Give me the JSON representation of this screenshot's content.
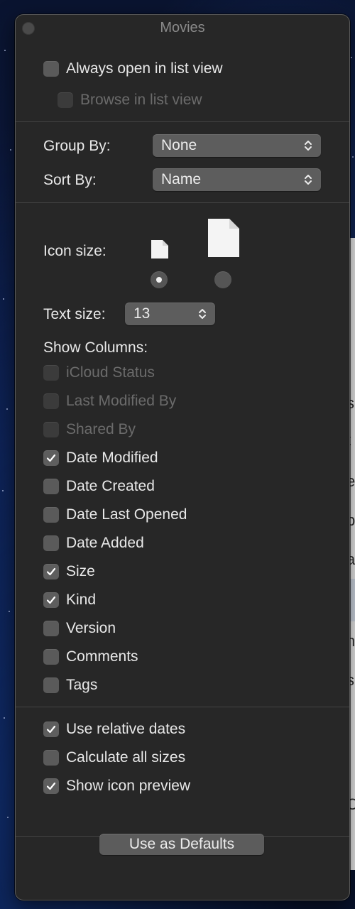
{
  "window": {
    "title": "Movies"
  },
  "top_options": [
    {
      "label": "Always open in list view",
      "checked": false,
      "disabled": false
    },
    {
      "label": "Browse in list view",
      "checked": false,
      "disabled": true
    }
  ],
  "group_by": {
    "label": "Group By:",
    "value": "None"
  },
  "sort_by": {
    "label": "Sort By:",
    "value": "Name"
  },
  "icon_size": {
    "label": "Icon size:",
    "selected": "small"
  },
  "text_size": {
    "label": "Text size:",
    "value": "13"
  },
  "show_columns": {
    "label": "Show Columns:",
    "items": [
      {
        "label": "iCloud Status",
        "checked": false,
        "disabled": true
      },
      {
        "label": "Last Modified By",
        "checked": false,
        "disabled": true
      },
      {
        "label": "Shared By",
        "checked": false,
        "disabled": true
      },
      {
        "label": "Date Modified",
        "checked": true,
        "disabled": false
      },
      {
        "label": "Date Created",
        "checked": false,
        "disabled": false
      },
      {
        "label": "Date Last Opened",
        "checked": false,
        "disabled": false
      },
      {
        "label": "Date Added",
        "checked": false,
        "disabled": false
      },
      {
        "label": "Size",
        "checked": true,
        "disabled": false
      },
      {
        "label": "Kind",
        "checked": true,
        "disabled": false
      },
      {
        "label": "Version",
        "checked": false,
        "disabled": false
      },
      {
        "label": "Comments",
        "checked": false,
        "disabled": false
      },
      {
        "label": "Tags",
        "checked": false,
        "disabled": false
      }
    ]
  },
  "bottom_options": [
    {
      "label": "Use relative dates",
      "checked": true,
      "disabled": false
    },
    {
      "label": "Calculate all sizes",
      "checked": false,
      "disabled": false
    },
    {
      "label": "Show icon preview",
      "checked": true,
      "disabled": false
    }
  ],
  "defaults_button": {
    "label": "Use as Defaults"
  },
  "background_window_fragments": [
    "s",
    "t",
    "e",
    "p",
    "a",
    "n",
    "s",
    "C"
  ]
}
